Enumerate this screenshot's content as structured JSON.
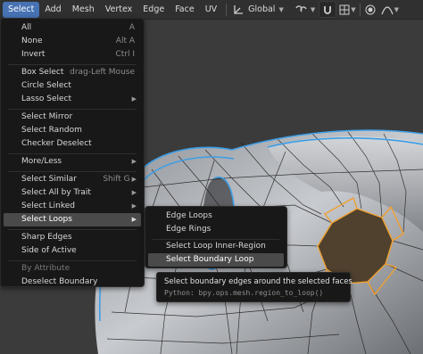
{
  "header": {
    "menus": [
      "Select",
      "Add",
      "Mesh",
      "Vertex",
      "Edge",
      "Face",
      "UV"
    ],
    "transform_orientation": "Global"
  },
  "select_menu": {
    "items": [
      {
        "label": "All",
        "shortcut": "A"
      },
      {
        "label": "None",
        "shortcut": "Alt A"
      },
      {
        "label": "Invert",
        "shortcut": "Ctrl I"
      },
      {
        "label": "Box Select",
        "shortcut": "drag-Left Mouse"
      },
      {
        "label": "Circle Select",
        "shortcut": ""
      },
      {
        "label": "Lasso Select",
        "shortcut": ""
      },
      {
        "label": "Select Mirror",
        "shortcut": ""
      },
      {
        "label": "Select Random",
        "shortcut": ""
      },
      {
        "label": "Checker Deselect",
        "shortcut": ""
      },
      {
        "label": "More/Less",
        "shortcut": ""
      },
      {
        "label": "Select Similar",
        "shortcut": "Shift G"
      },
      {
        "label": "Select All by Trait",
        "shortcut": ""
      },
      {
        "label": "Select Linked",
        "shortcut": ""
      },
      {
        "label": "Select Loops",
        "shortcut": ""
      },
      {
        "label": "Sharp Edges",
        "shortcut": ""
      },
      {
        "label": "Side of Active",
        "shortcut": ""
      },
      {
        "label": "By Attribute",
        "shortcut": ""
      },
      {
        "label": "Deselect Boundary",
        "shortcut": ""
      }
    ]
  },
  "loops_submenu": {
    "items": [
      {
        "label": "Edge Loops"
      },
      {
        "label": "Edge Rings"
      },
      {
        "label": "Select Loop Inner-Region"
      },
      {
        "label": "Select Boundary Loop"
      }
    ]
  },
  "tooltip": {
    "description": "Select boundary edges around the selected faces.",
    "python": "Python: bpy.ops.mesh.region_to_loop()"
  },
  "colors": {
    "accent": "#4772b3",
    "selection": "#f0a030",
    "wire_highlight": "#3d9ee6"
  }
}
